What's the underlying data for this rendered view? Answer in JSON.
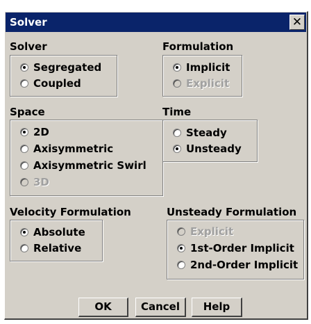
{
  "window": {
    "title": "Solver",
    "close_glyph": "✕"
  },
  "groups": {
    "solver": {
      "label": "Solver",
      "options": [
        {
          "label": "Segregated",
          "selected": true,
          "disabled": false
        },
        {
          "label": "Coupled",
          "selected": false,
          "disabled": false
        }
      ]
    },
    "formulation": {
      "label": "Formulation",
      "options": [
        {
          "label": "Implicit",
          "selected": true,
          "disabled": false
        },
        {
          "label": "Explicit",
          "selected": false,
          "disabled": true
        }
      ]
    },
    "space": {
      "label": "Space",
      "options": [
        {
          "label": "2D",
          "selected": true,
          "disabled": false
        },
        {
          "label": "Axisymmetric",
          "selected": false,
          "disabled": false
        },
        {
          "label": "Axisymmetric Swirl",
          "selected": false,
          "disabled": false
        },
        {
          "label": "3D",
          "selected": false,
          "disabled": true
        }
      ]
    },
    "time": {
      "label": "Time",
      "options": [
        {
          "label": "Steady",
          "selected": false,
          "disabled": false
        },
        {
          "label": "Unsteady",
          "selected": true,
          "disabled": false
        }
      ]
    },
    "velocity": {
      "label": "Velocity Formulation",
      "options": [
        {
          "label": "Absolute",
          "selected": true,
          "disabled": false
        },
        {
          "label": "Relative",
          "selected": false,
          "disabled": false
        }
      ]
    },
    "unsteady": {
      "label": "Unsteady Formulation",
      "options": [
        {
          "label": "Explicit",
          "selected": false,
          "disabled": true
        },
        {
          "label": "1st-Order Implicit",
          "selected": true,
          "disabled": false
        },
        {
          "label": "2nd-Order Implicit",
          "selected": false,
          "disabled": false
        }
      ]
    }
  },
  "buttons": {
    "ok": "OK",
    "cancel": "Cancel",
    "help": "Help"
  }
}
